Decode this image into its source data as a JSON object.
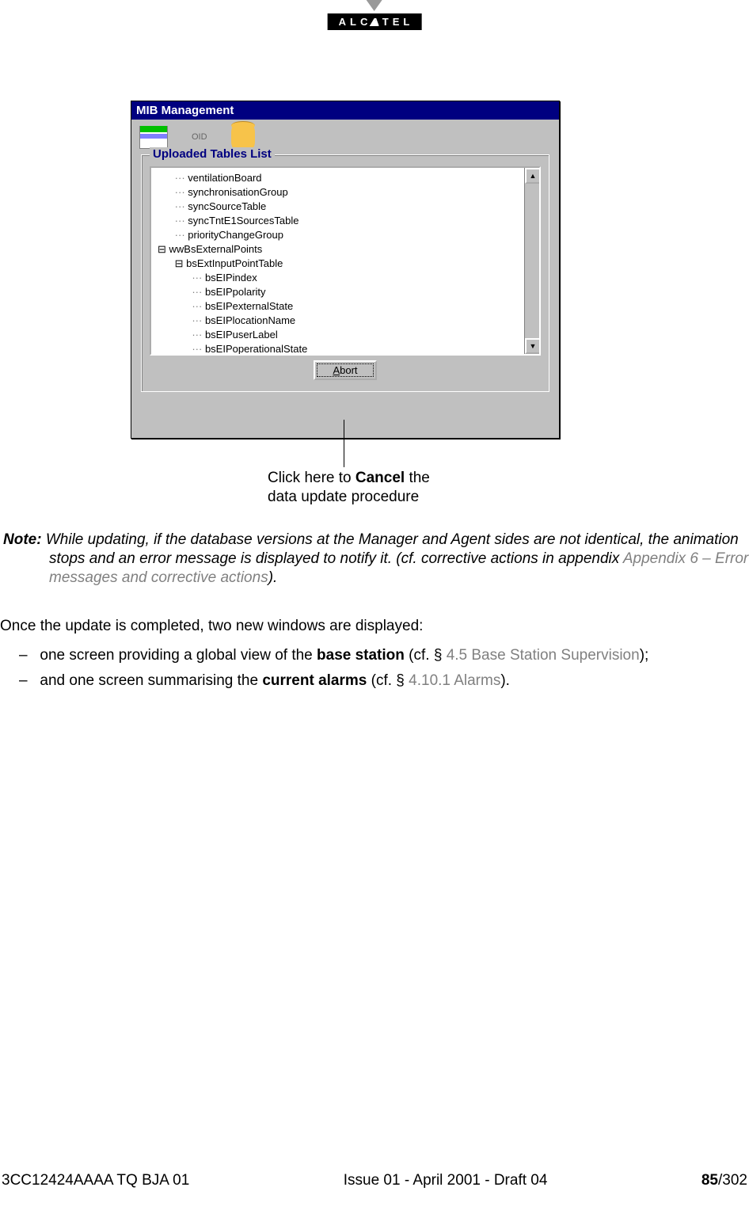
{
  "brand": "ALCATEL",
  "window": {
    "title": "MIB Management",
    "oid_label": "OID",
    "group_title": "Uploaded Tables List",
    "tree": [
      {
        "indent": 1,
        "prefix": "",
        "label": "ventilationBoard"
      },
      {
        "indent": 1,
        "prefix": "",
        "label": "synchronisationGroup"
      },
      {
        "indent": 1,
        "prefix": "",
        "label": "syncSourceTable"
      },
      {
        "indent": 1,
        "prefix": "",
        "label": "syncTntE1SourcesTable"
      },
      {
        "indent": 1,
        "prefix": "",
        "label": "priorityChangeGroup"
      },
      {
        "indent": 0,
        "prefix": "⊟ ",
        "label": "wwBsExternalPoints"
      },
      {
        "indent": 1,
        "prefix": "⊟ ",
        "label": "bsExtInputPointTable"
      },
      {
        "indent": 2,
        "prefix": "",
        "label": "bsEIPindex"
      },
      {
        "indent": 2,
        "prefix": "",
        "label": "bsEIPpolarity"
      },
      {
        "indent": 2,
        "prefix": "",
        "label": "bsEIPexternalState"
      },
      {
        "indent": 2,
        "prefix": "",
        "label": "bsEIPlocationName"
      },
      {
        "indent": 2,
        "prefix": "",
        "label": "bsEIPuserLabel"
      },
      {
        "indent": 2,
        "prefix": "",
        "label": "bsEIPoperationalState"
      }
    ],
    "abort_underline": "A",
    "abort_rest": "bort"
  },
  "callout": {
    "line1_pre": "Click here to ",
    "line1_bold": "Cancel",
    "line1_post": " the",
    "line2": "data update procedure"
  },
  "note": {
    "label": "Note:",
    "text1": " While updating, if the database versions at the Manager and Agent sides are not identical, the animation stops and an error message is displayed to notify it. (cf. corrective actions in appendix ",
    "link": "Appendix 6 – Error messages and corrective actions",
    "text2": ")."
  },
  "para_after": "Once the update is completed, two new windows are displayed:",
  "bullets": [
    {
      "pre": "one screen providing a global view of the ",
      "bold": "base station",
      "mid": " (cf. § ",
      "grey": "4.5 Base Station Supervision",
      "post": ");"
    },
    {
      "pre": "and one screen summarising the ",
      "bold": "current alarms",
      "mid": " (cf. § ",
      "grey": "4.10.1 Alarms",
      "post": ")."
    }
  ],
  "footer": {
    "left": "3CC12424AAAA TQ BJA 01",
    "center": "Issue 01 - April 2001 - Draft 04",
    "page_bold": "85",
    "page_rest": "/302"
  }
}
